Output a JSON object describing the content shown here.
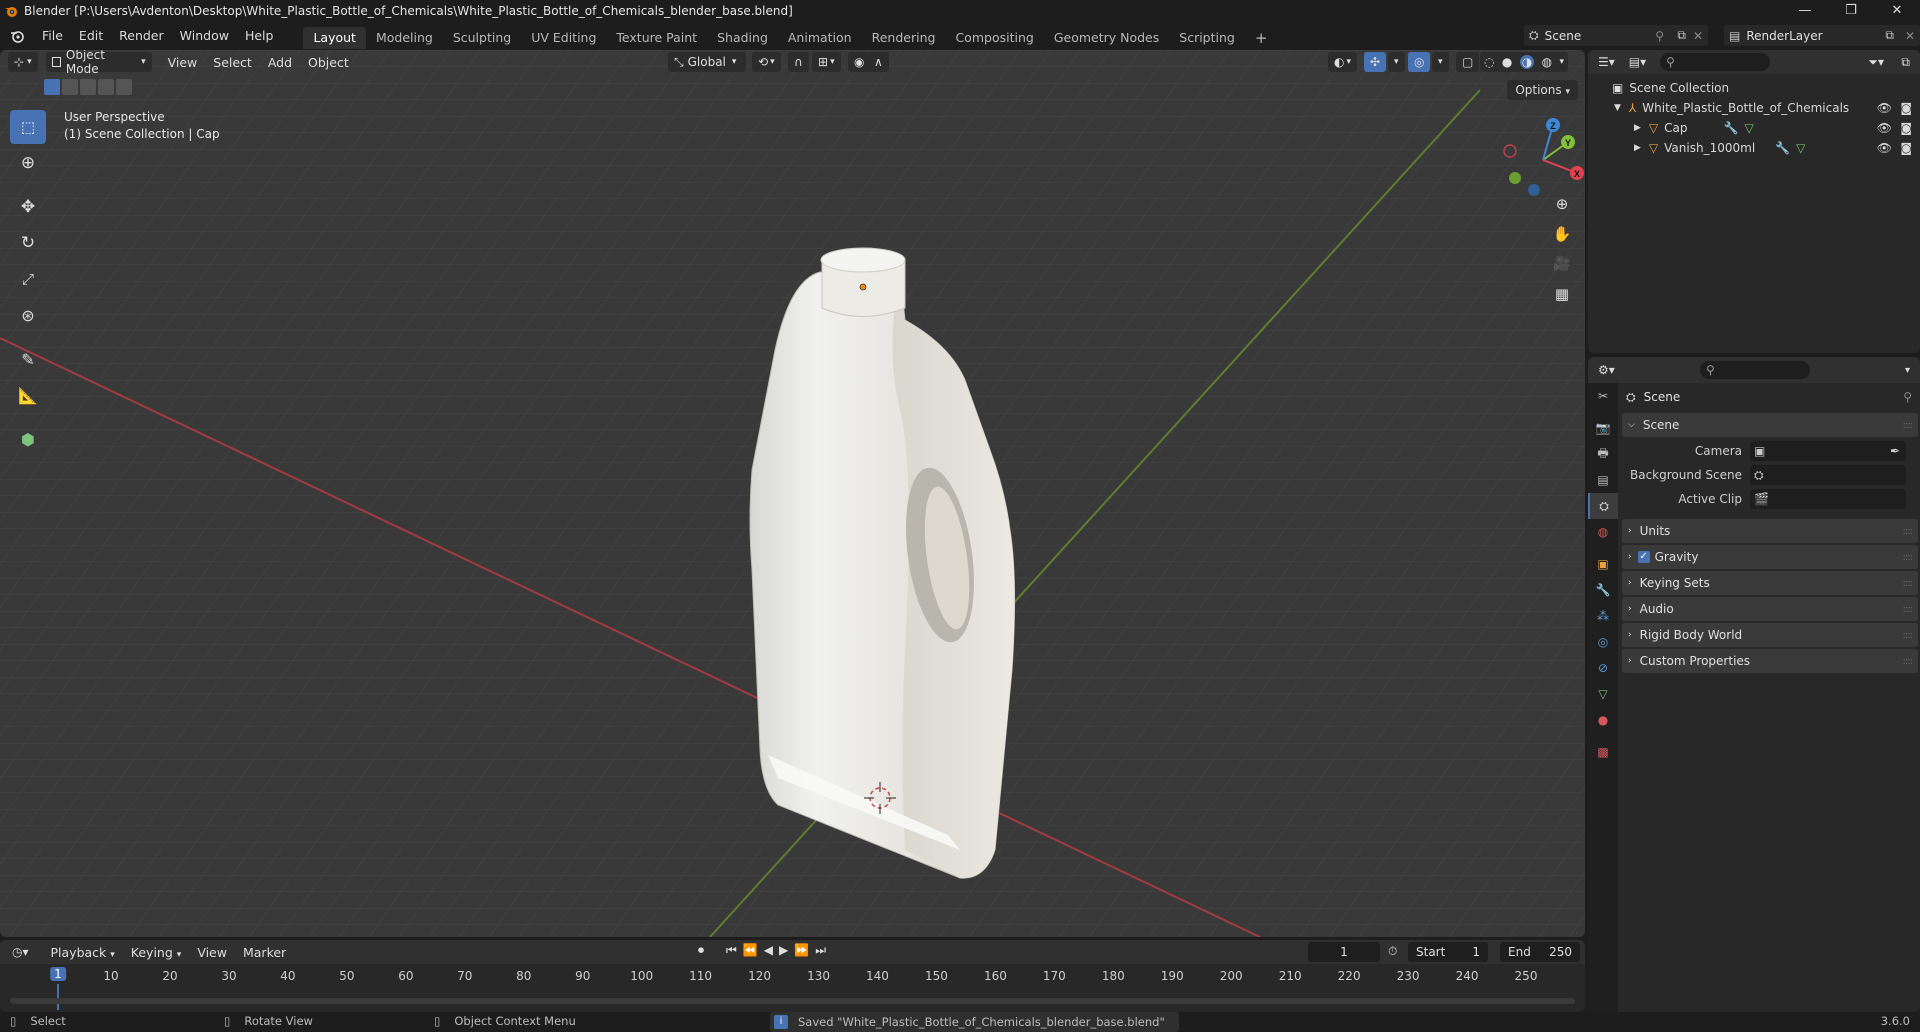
{
  "window": {
    "title": "Blender [P:\\Users\\Avdenton\\Desktop\\White_Plastic_Bottle_of_Chemicals\\White_Plastic_Bottle_of_Chemicals_blender_base.blend]",
    "minimize": "—",
    "maximize": "❐",
    "close": "✕"
  },
  "menu": [
    "File",
    "Edit",
    "Render",
    "Window",
    "Help"
  ],
  "workspaces": [
    "Layout",
    "Modeling",
    "Sculpting",
    "UV Editing",
    "Texture Paint",
    "Shading",
    "Animation",
    "Rendering",
    "Compositing",
    "Geometry Nodes",
    "Scripting"
  ],
  "active_workspace": "Layout",
  "add_workspace": "+",
  "scene_selector": "Scene",
  "render_layer": "RenderLayer",
  "viewport": {
    "mode": "Object Mode",
    "menus": [
      "View",
      "Select",
      "Add",
      "Object"
    ],
    "transform_orientation": "Global",
    "options_label": "Options",
    "info_line1": "User Perspective",
    "info_line2": "(1) Scene Collection | Cap",
    "gizmo": {
      "x": "X",
      "y": "Y",
      "z": "Z"
    }
  },
  "outliner": {
    "root": "Scene Collection",
    "items": [
      {
        "name": "White_Plastic_Bottle_of_Chemicals",
        "type": "empty"
      },
      {
        "name": "Cap",
        "type": "mesh"
      },
      {
        "name": "Vanish_1000ml",
        "type": "mesh"
      }
    ]
  },
  "properties": {
    "context": "Scene",
    "scene_panel": "Scene",
    "camera_label": "Camera",
    "background_scene_label": "Background Scene",
    "active_clip_label": "Active Clip",
    "panels": [
      "Units",
      "Gravity",
      "Keying Sets",
      "Audio",
      "Rigid Body World",
      "Custom Properties"
    ],
    "gravity_checked": true
  },
  "timeline": {
    "menus": [
      "Playback",
      "Keying",
      "View",
      "Marker"
    ],
    "current_frame": "1",
    "start_label": "Start",
    "start": "1",
    "end_label": "End",
    "end": "250",
    "ticks": [
      "1",
      "10",
      "20",
      "30",
      "40",
      "50",
      "60",
      "70",
      "80",
      "90",
      "100",
      "110",
      "120",
      "130",
      "140",
      "150",
      "160",
      "170",
      "180",
      "190",
      "200",
      "210",
      "220",
      "230",
      "240",
      "250"
    ]
  },
  "statusbar": {
    "select": "Select",
    "rotate": "Rotate View",
    "context_menu": "Object Context Menu",
    "message": "Saved \"White_Plastic_Bottle_of_Chemicals_blender_base.blend\"",
    "version": "3.6.0"
  },
  "colors": {
    "accent": "#4772b3",
    "x_axis": "#e0434f",
    "y_axis": "#82bf3a",
    "z_axis": "#3d87d6"
  }
}
